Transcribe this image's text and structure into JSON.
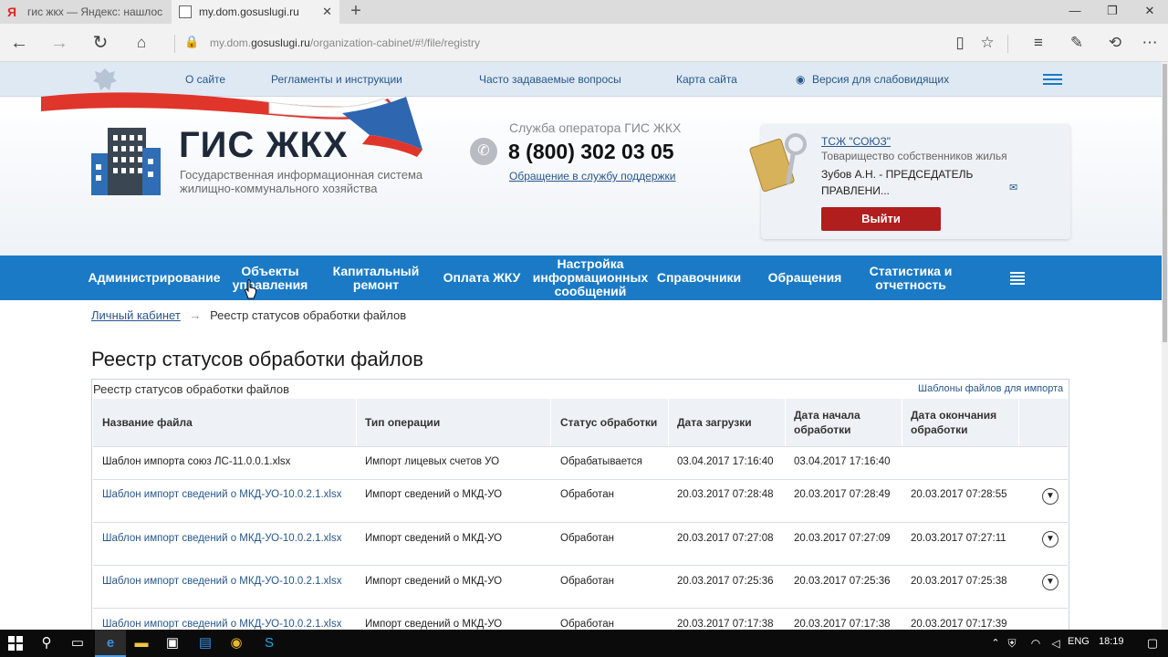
{
  "browser": {
    "tabs": [
      {
        "title": "гис жкх — Яндекс: нашлос"
      },
      {
        "title": "my.dom.gosuslugi.ru"
      }
    ],
    "url_host_prefix": "my.dom.",
    "url_host_main": "gosuslugi.ru",
    "url_path": "/organization-cabinet/#!/file/registry"
  },
  "site_top_links": [
    "О сайте",
    "Регламенты и инструкции",
    "Часто задаваемые вопросы",
    "Карта сайта",
    "Версия для слабовидящих"
  ],
  "header": {
    "logo_title": "ГИС ЖКХ",
    "logo_subtitle": "Государственная информационная система жилищно-коммунального хозяйства",
    "service_title": "Служба оператора ГИС ЖКХ",
    "service_phone": "8 (800) 302 03 05",
    "service_link": "Обращение в службу поддержки",
    "org_name": "ТСЖ \"СОЮЗ\"",
    "org_type": "Товарищество собственников жилья",
    "org_person": "Зубов А.Н. - ПРЕДСЕДАТЕЛЬ ПРАВЛЕНИ...",
    "logout": "Выйти"
  },
  "main_nav": [
    "Администрирование",
    "Объекты управления",
    "Капитальный ремонт",
    "Оплата ЖКУ",
    "Настройка информационных сообщений",
    "Справочники",
    "Обращения",
    "Статистика и отчетность"
  ],
  "breadcrumb": {
    "home": "Личный кабинет",
    "arrow": "→",
    "current": "Реестр статусов обработки файлов"
  },
  "page_title": "Реестр статусов обработки файлов",
  "panel": {
    "title": "Реестр статусов обработки файлов",
    "templates_link": "Шаблоны файлов для импорта"
  },
  "table": {
    "headers": [
      "Название файла",
      "Тип операции",
      "Статус обработки",
      "Дата загрузки",
      "Дата начала обработки",
      "Дата окончания обработки"
    ],
    "rows": [
      {
        "file": "Шаблон импорта союз ЛС-11.0.0.1.xlsx",
        "op": "Импорт лицевых счетов УО",
        "status": "Обрабатывается",
        "loaded": "03.04.2017 17:16:40",
        "start": "03.04.2017 17:16:40",
        "end": ""
      },
      {
        "file": "Шаблон импорт сведений о МКД-УО-10.0.2.1.xlsx",
        "op": "Импорт сведений о МКД-УО",
        "status": "Обработан",
        "loaded": "20.03.2017 07:28:48",
        "start": "20.03.2017 07:28:49",
        "end": "20.03.2017 07:28:55"
      },
      {
        "file": "Шаблон импорт сведений о МКД-УО-10.0.2.1.xlsx",
        "op": "Импорт сведений о МКД-УО",
        "status": "Обработан",
        "loaded": "20.03.2017 07:27:08",
        "start": "20.03.2017 07:27:09",
        "end": "20.03.2017 07:27:11"
      },
      {
        "file": "Шаблон импорт сведений о МКД-УО-10.0.2.1.xlsx",
        "op": "Импорт сведений о МКД-УО",
        "status": "Обработан",
        "loaded": "20.03.2017 07:25:36",
        "start": "20.03.2017 07:25:36",
        "end": "20.03.2017 07:25:38"
      },
      {
        "file": "Шаблон импорт сведений о МКД-УО-10.0.2.1.xlsx",
        "op": "Импорт сведений о МКД-УО",
        "status": "Обработан",
        "loaded": "20.03.2017 07:17:38",
        "start": "20.03.2017 07:17:38",
        "end": "20.03.2017 07:17:39"
      }
    ]
  },
  "taskbar": {
    "lang": "ENG",
    "time": "18:19"
  },
  "colors": {
    "nav_blue": "#1a7ac6",
    "link_blue": "#27578b",
    "logout_red": "#b01e1e"
  }
}
